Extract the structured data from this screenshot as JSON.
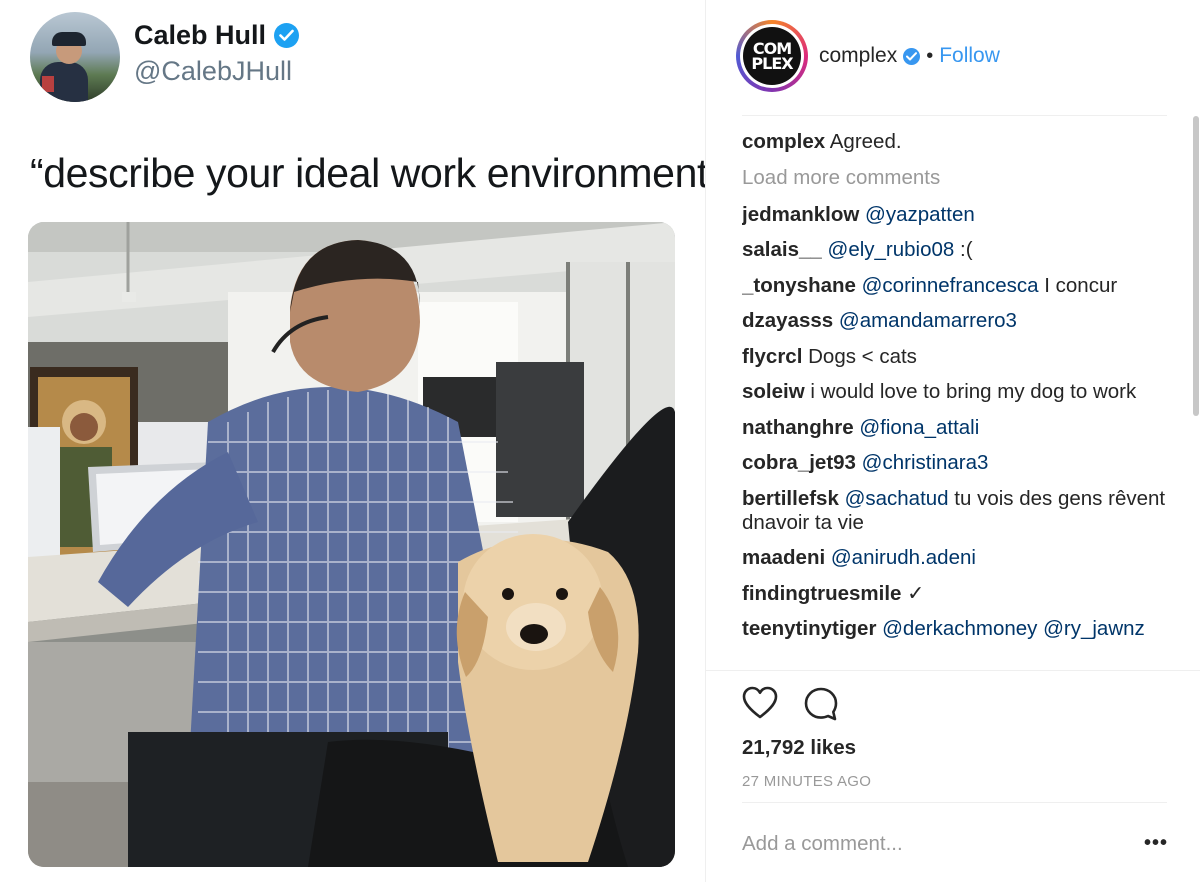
{
  "tweet": {
    "name": "Caleb Hull",
    "handle": "@CalebJHull",
    "text": "“describe your ideal work environment”",
    "verified_icon": "verified-badge-icon",
    "accent_color": "#1da1f2"
  },
  "instagram": {
    "avatar_text_line1": "COM",
    "avatar_text_line2": "PLEX",
    "account_name": "complex",
    "separator": "•",
    "follow_label": "Follow",
    "load_more": "Load more comments",
    "comments": [
      {
        "user": "complex",
        "mention": "",
        "text": "Agreed."
      },
      {
        "user": "jedmanklow",
        "mention": "@yazpatten",
        "text": ""
      },
      {
        "user": "salais__",
        "mention": "@ely_rubio08",
        "text": ":("
      },
      {
        "user": "_tonyshane",
        "mention": "@corinnefrancesca",
        "text": "I concur"
      },
      {
        "user": "dzayasss",
        "mention": "@amandamarrero3",
        "text": ""
      },
      {
        "user": "flycrcl",
        "mention": "",
        "text": "Dogs < cats"
      },
      {
        "user": "soleiw",
        "mention": "",
        "text": "i would love to bring my dog to work"
      },
      {
        "user": "nathanghre",
        "mention": "@fiona_attali",
        "text": ""
      },
      {
        "user": "cobra_jet93",
        "mention": "@christinara3",
        "text": ""
      },
      {
        "user": "bertillefsk",
        "mention": "@sachatud",
        "text": "tu vois des gens rêvent dnavoir ta vie"
      },
      {
        "user": "maadeni",
        "mention": "@anirudh.adeni",
        "text": ""
      },
      {
        "user": "findingtruesmile",
        "mention": "",
        "text": "✓"
      },
      {
        "user": "teenytinytiger",
        "mention": "@derkachmoney @ry_jawnz",
        "text": ""
      }
    ],
    "likes": "21,792 likes",
    "time": "27 MINUTES AGO",
    "add_comment_placeholder": "Add a comment...",
    "more_label": "•••",
    "icons": [
      "heart-icon",
      "comment-icon",
      "more-options-icon"
    ],
    "link_color": "#3897f0",
    "mention_color": "#003569"
  }
}
